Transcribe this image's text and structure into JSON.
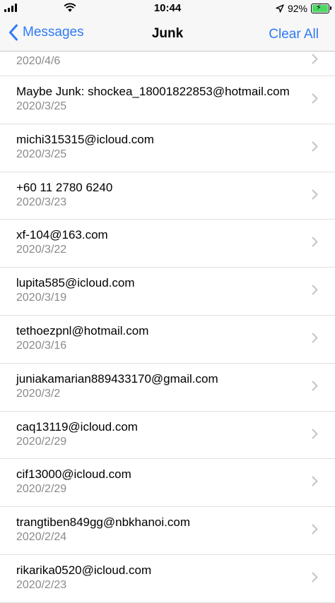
{
  "status_bar": {
    "time": "10:44",
    "battery_percent": "92%",
    "battery_level": 0.92,
    "icons": [
      "signal-icon",
      "wifi-icon",
      "location-icon",
      "battery-icon"
    ]
  },
  "nav": {
    "back_label": "Messages",
    "title": "Junk",
    "clear_label": "Clear All"
  },
  "colors": {
    "accent": "#2f7bf6",
    "secondary_text": "#8a8a8e",
    "battery_fill": "#4cd964"
  },
  "messages": [
    {
      "sender": "",
      "date": "2020/4/6"
    },
    {
      "sender": "Maybe Junk: shockea_18001822853@hotmail.com",
      "date": "2020/3/25"
    },
    {
      "sender": "michi315315@icloud.com",
      "date": "2020/3/25"
    },
    {
      "sender": "+60 11 2780 6240",
      "date": "2020/3/23"
    },
    {
      "sender": "xf-104@163.com",
      "date": "2020/3/22"
    },
    {
      "sender": "lupita585@icloud.com",
      "date": "2020/3/19"
    },
    {
      "sender": "tethoezpnl@hotmail.com",
      "date": "2020/3/16"
    },
    {
      "sender": "juniakamarian889433170@gmail.com",
      "date": "2020/3/2"
    },
    {
      "sender": "caq13119@icloud.com",
      "date": "2020/2/29"
    },
    {
      "sender": "cif13000@icloud.com",
      "date": "2020/2/29"
    },
    {
      "sender": "trangtiben849gg@nbkhanoi.com",
      "date": "2020/2/24"
    },
    {
      "sender": "rikarika0520@icloud.com",
      "date": "2020/2/23"
    }
  ]
}
